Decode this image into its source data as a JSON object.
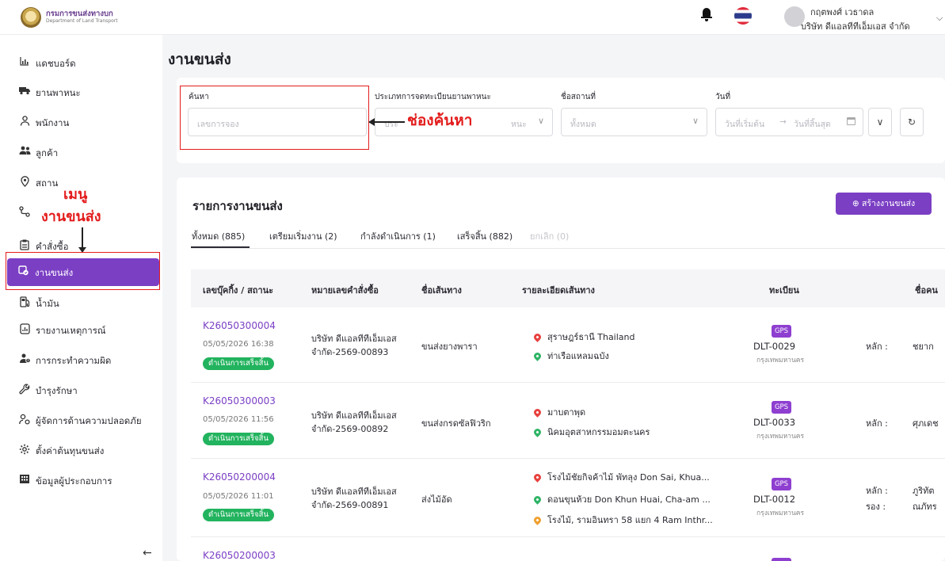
{
  "app": {
    "org_th": "กรมการขนส่งทางบก",
    "org_en": "Department of Land Transport"
  },
  "topbar": {
    "user_name": "กฤตพงศ์ เวธาดล",
    "company": "บริษัท ดีแอลทีทีเอ็มเอส จำกัด",
    "icons": [
      "bell-icon",
      "thai-flag",
      "avatar",
      "chevron-down-icon"
    ]
  },
  "sidebar": {
    "items": [
      {
        "label": "แดชบอร์ด",
        "icon": "dashboard-icon"
      },
      {
        "label": "ยานพาหนะ",
        "icon": "truck-icon"
      },
      {
        "label": "พนักงาน",
        "icon": "person-icon"
      },
      {
        "label": "ลูกค้า",
        "icon": "group-icon"
      },
      {
        "label": "สถาน",
        "icon": "location-pin-icon"
      },
      {
        "label": "",
        "icon": "route-icon"
      },
      {
        "label": "คำสั่งซื้อ",
        "icon": "clipboard-icon"
      },
      {
        "label": "งานขนส่ง",
        "icon": "shipment-icon",
        "active": true
      },
      {
        "label": "น้ำมัน",
        "icon": "fuel-icon"
      },
      {
        "label": "รายงานเหตุการณ์",
        "icon": "report-icon"
      },
      {
        "label": "การกระทำความผิด",
        "icon": "violation-icon"
      },
      {
        "label": "บำรุงรักษา",
        "icon": "wrench-icon"
      },
      {
        "label": "ผู้จัดการด้านความปลอดภัย",
        "icon": "safety-manager-icon"
      },
      {
        "label": "ตั้งค่าต้นทุนขนส่ง",
        "icon": "settings-icon"
      },
      {
        "label": "ข้อมูลผู้ประกอบการ",
        "icon": "building-icon"
      }
    ]
  },
  "annotations": {
    "menu_line1": "เมนู",
    "menu_line2": "งานขนส่ง",
    "search_label": "ช่องค้นหา"
  },
  "page": {
    "title": "งานขนส่ง"
  },
  "filters": {
    "search_label": "ค้นหา",
    "search_placeholder": "เลขการจอง",
    "vehicle_type_label": "ประเภทการจดทะเบียนยานพาหนะ",
    "vehicle_type_placeholder_left": "ประ",
    "vehicle_type_placeholder_right": "หนะ",
    "location_label": "ชื่อสถานที่",
    "location_value": "ทั้งหมด",
    "date_label": "วันที่",
    "date_start_placeholder": "วันที่เริ่มต้น",
    "date_arrow": "→",
    "date_end_placeholder": "วันที่สิ้นสุด"
  },
  "list": {
    "title": "รายการงานขนส่ง",
    "create_button": "⊕  สร้างงานขนส่ง",
    "tabs": [
      {
        "label": "ทั้งหมด (885)",
        "active": true
      },
      {
        "label": "เตรียมเริ่มงาน (2)"
      },
      {
        "label": "กำลังดำเนินการ (1)"
      },
      {
        "label": "เสร็จสิ้น (882)"
      },
      {
        "label": "ยกเลิก (0)",
        "disabled": true
      }
    ],
    "columns": [
      "เลขบุ๊คกิ้ง / สถานะ",
      "หมายเลขคำสั่งซื้อ",
      "ชื่อเส้นทาง",
      "รายละเอียดเส้นทาง",
      "ทะเบียน",
      "ชื่อคน"
    ],
    "rows": [
      {
        "job_id": "K26050300004",
        "date": "05/05/2026 16:38",
        "status": "ดำเนินการเสร็จสิ้น",
        "order_line1": "บริษัท ดีแอลทีทีเอ็มเอส",
        "order_line2": "จำกัด-2569-00893",
        "route_name": "ขนส่งยางพารา",
        "stops": [
          {
            "text": "สุราษฎร์ธานี Thailand",
            "color": "red"
          },
          {
            "text": "ท่าเรือแหลมฉบัง",
            "color": "green"
          }
        ],
        "gps": "GPS",
        "plate": "DLT-0029",
        "province": "กรุงเทพมหานคร",
        "drivers": [
          {
            "role": "หลัก :",
            "name": "ชยาก"
          }
        ]
      },
      {
        "job_id": "K26050300003",
        "date": "05/05/2026 11:56",
        "status": "ดำเนินการเสร็จสิ้น",
        "order_line1": "บริษัท ดีแอลทีทีเอ็มเอส",
        "order_line2": "จำกัด-2569-00892",
        "route_name": "ขนส่งกรดซัลฟิวริก",
        "stops": [
          {
            "text": "มาบตาพุด",
            "color": "red"
          },
          {
            "text": "นิคมอุตสาหกรรมอมตะนคร",
            "color": "green"
          }
        ],
        "gps": "GPS",
        "plate": "DLT-0033",
        "province": "กรุงเทพมหานคร",
        "drivers": [
          {
            "role": "หลัก :",
            "name": "ศุภเดช"
          }
        ]
      },
      {
        "job_id": "K26050200004",
        "date": "05/05/2026 11:01",
        "status": "ดำเนินการเสร็จสิ้น",
        "order_line1": "บริษัท ดีแอลทีทีเอ็มเอส",
        "order_line2": "จำกัด-2569-00891",
        "route_name": "ส่งไม้อัด",
        "stops": [
          {
            "text": "โรงไม้ชัยกิจค้าไม้ พัทลุง Don Sai, Khua...",
            "color": "red"
          },
          {
            "text": "ดอนขุนห้วย Don Khun Huai, Cha-am ...",
            "color": "green"
          },
          {
            "text": "โรงไม้, รามอินทรา 58 แยก 4 Ram Inthr...",
            "color": "orange"
          }
        ],
        "gps": "GPS",
        "plate": "DLT-0012",
        "province": "กรุงเทพมหานคร",
        "drivers": [
          {
            "role": "หลัก :",
            "name": "ภูริทัต"
          },
          {
            "role": "รอง :",
            "name": "ณภัทร"
          }
        ]
      },
      {
        "job_id": "K26050200003"
      }
    ]
  },
  "colors": {
    "accent": "#7b3fc4",
    "status_green": "#22b35e",
    "annotation_red": "#e31c1c",
    "gps_purple": "#8e3fd0"
  }
}
